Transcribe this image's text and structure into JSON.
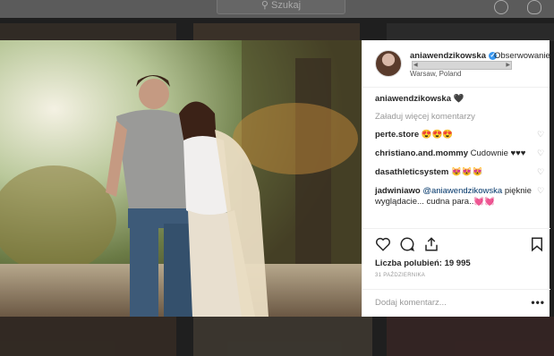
{
  "topbar": {
    "search_placeholder": "Szukaj",
    "icons": [
      "search-icon",
      "compass-icon",
      "heart-icon"
    ]
  },
  "post": {
    "username": "aniawendzikowska",
    "verified": true,
    "follow_label": "Obserwowanie",
    "location": "Warsaw, Poland",
    "caption_user": "aniawendzikowska",
    "caption_text": "🖤",
    "load_more": "Załaduj więcej komentarzy",
    "comments": [
      {
        "user": "perte.store",
        "text": "😍😍😍"
      },
      {
        "user": "christiano.and.mommy",
        "text": "Cudownie ♥♥♥"
      },
      {
        "user": "dasathleticsystem",
        "text": "😻😻😻"
      },
      {
        "user": "jadwiniawo",
        "mention": "@aniawendzikowska",
        "text": "pięknie wyglądacie... cudna para..💓💓"
      }
    ],
    "likes": "Liczba polubień: 19 995",
    "date": "31 PAŹDZIERNIKA",
    "add_comment_placeholder": "Dodaj komentarz...",
    "more_label": "•••"
  },
  "colors": {
    "link": "#003569",
    "verified": "#3897f0",
    "muted": "#999999"
  }
}
